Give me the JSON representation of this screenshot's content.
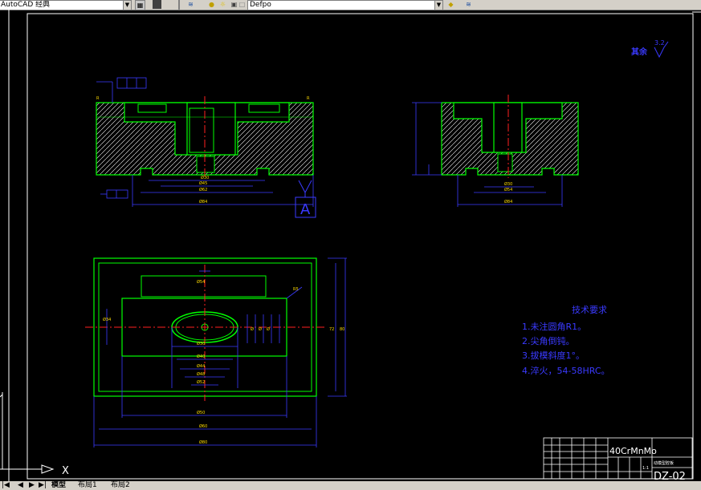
{
  "toolbar": {
    "workspace_value": "AutoCAD 经典",
    "layer_value": "Defpo"
  },
  "drawing": {
    "roughness_label": "其余",
    "roughness_value": "3.2",
    "section_label": "A",
    "tech_title": "技术要求",
    "tech_notes": [
      "1.未注圆角R1。",
      "2.尖角倒钝。",
      "3.拔模斜度1°。",
      "4.淬火，54-58HRC。"
    ],
    "material": "40CrMnMo",
    "drawing_number": "DZ-02",
    "scale": "1:1",
    "part_name": "动模型腔板"
  },
  "ucs": {
    "x_label": "X"
  },
  "layout_tabs": [
    "模型",
    "布局1",
    "布局2"
  ],
  "colors": {
    "outline": "#00ff00",
    "centerline": "#ff2020",
    "dimension": "#3a3aff",
    "frame": "#ffffff",
    "hatch": "#ffffff"
  }
}
